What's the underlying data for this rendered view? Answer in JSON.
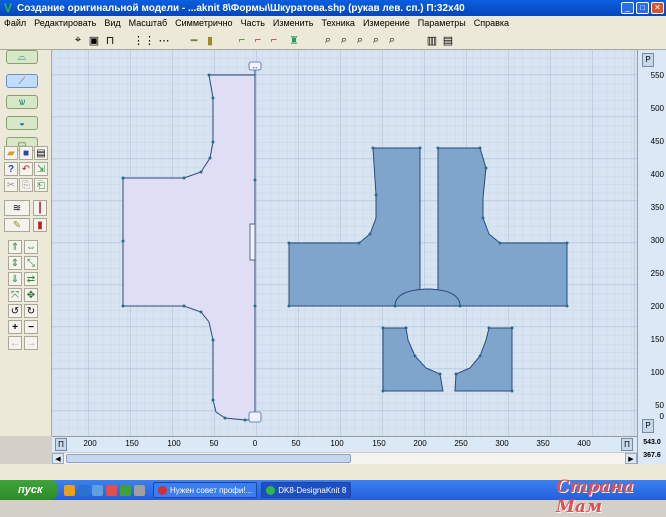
{
  "window": {
    "title": "Создание оригинальной модели - ...aknit 8\\Формы\\Шкуратова.shp (рукав лев. сп.)     П:32x40",
    "min": "_",
    "max": "□",
    "close": "✕"
  },
  "menu": [
    "Файл",
    "Редактировать",
    "Вид",
    "Масштаб",
    "Симметрично",
    "Часть",
    "Изменить",
    "Техника",
    "Измерение",
    "Параметры",
    "Справка"
  ],
  "toolbar_icons": [
    "pointer-icon",
    "print-icon",
    "shape-icon",
    "grid-icon",
    "grid-fine-icon",
    "line-icon",
    "marker-icon",
    "stairs-icon",
    "stairs-plus-icon",
    "stairs-minus-icon",
    "sweater-icon",
    "zoom-in-icon",
    "zoom-icon",
    "zoom-region-icon",
    "zoom-fit-icon",
    "zoom-out-icon",
    "book-icon",
    "pages-icon"
  ],
  "rulers": {
    "vertical": [
      "550",
      "500",
      "450",
      "400",
      "350",
      "300",
      "250",
      "200",
      "150",
      "100",
      "50",
      "0"
    ],
    "horizontal": [
      "200",
      "150",
      "100",
      "50",
      "0",
      "50",
      "100",
      "150",
      "200",
      "250",
      "300",
      "350",
      "400"
    ],
    "p_label": "P",
    "h_p_label": "П"
  },
  "readout": {
    "x": "543.0",
    "y": "367.6"
  },
  "colors": {
    "canvas": "#d8e4f2",
    "grid": "#b8c9de",
    "grid_major": "#9db3cf",
    "shape_left": "#e0def5",
    "shape_right": "#7fa5cc",
    "outline": "#2b4a7a",
    "accent": "#e8432a"
  },
  "taskbar": {
    "start": "пуск",
    "tasks": [
      {
        "label": "Нужен совет профи!...",
        "color": "#d03030"
      },
      {
        "label": "DK8-DesignaKnit 8",
        "color": "#2fb84a"
      }
    ],
    "watermark": "Страна Мам"
  }
}
